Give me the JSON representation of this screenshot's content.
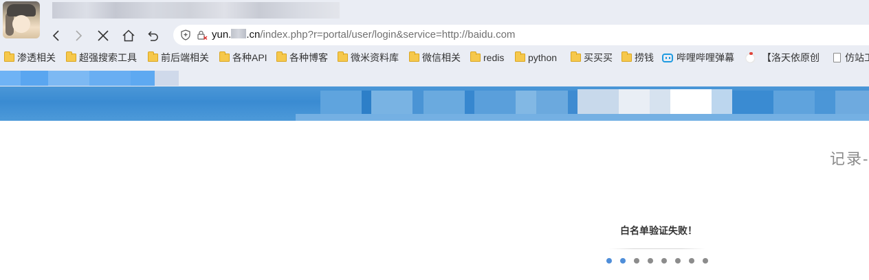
{
  "browser": {
    "address_bar": {
      "host_prefix": "yun.",
      "host_suffix": ".cn",
      "path": "/index.php?r=portal/user/login&service=http://baidu.com"
    },
    "nav": {
      "back_icon": "chevron-left-icon",
      "forward_icon": "chevron-right-icon",
      "stop_icon": "close-icon",
      "home_icon": "home-icon",
      "undo_icon": "undo-icon"
    },
    "bookmarks": [
      {
        "label": "渗透相关",
        "icon": "folder-icon"
      },
      {
        "label": "超强搜索工具",
        "icon": "folder-icon"
      },
      {
        "label": "前后端相关",
        "icon": "folder-icon"
      },
      {
        "label": "各种API",
        "icon": "folder-icon"
      },
      {
        "label": "各种博客",
        "icon": "folder-icon"
      },
      {
        "label": "微米资料库",
        "icon": "folder-icon"
      },
      {
        "label": "微信相关",
        "icon": "folder-icon"
      },
      {
        "label": "redis",
        "icon": "folder-icon"
      },
      {
        "label": "python",
        "icon": "folder-icon"
      },
      {
        "label": "买买买",
        "icon": "folder-icon"
      },
      {
        "label": "捞钱",
        "icon": "folder-icon"
      },
      {
        "label": "哔哩哔哩弹幕",
        "icon": "bilibili-icon"
      },
      {
        "label": "【洛天依原创",
        "icon": "chick-icon"
      },
      {
        "label": "仿站工",
        "icon": "page-icon"
      }
    ]
  },
  "page": {
    "side_text": "记录-",
    "status_message": "白名单验证失败！",
    "loader": {
      "total_dots": 8,
      "active_dots": 2,
      "active_color": "#4f8ed9",
      "inactive_color": "#8c8c8c"
    },
    "header_color": "#3a8bd2"
  }
}
